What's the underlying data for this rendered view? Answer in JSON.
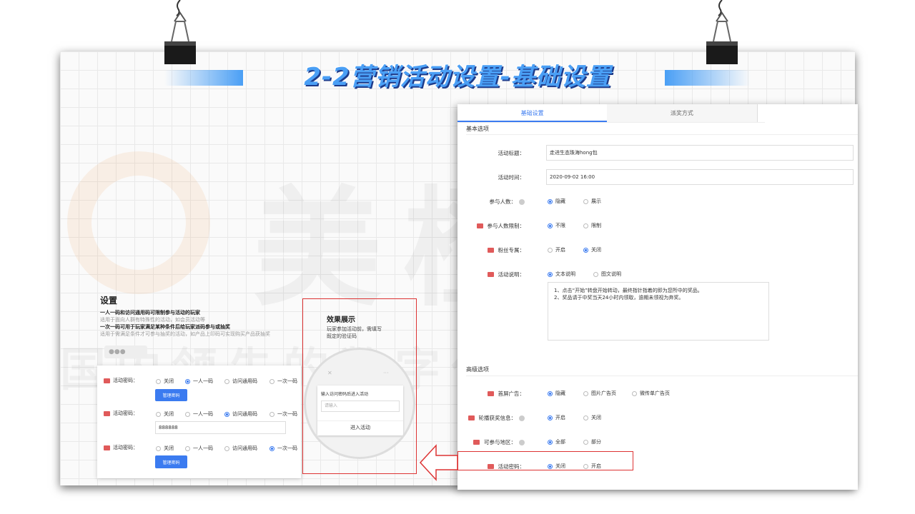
{
  "title": "2-2营销活动设置-基础设置",
  "watermark": {
    "big": "美橙互联",
    "line": "国内领先的数字化营销服务商"
  },
  "settings": {
    "heading": "设置",
    "lines": [
      {
        "text": "一人一码和访问通用码可限制参与活动的玩家",
        "style": "bold"
      },
      {
        "text": "适用于面向人群有特殊性的活动，如会员活动等",
        "style": "gray"
      },
      {
        "text": "一次一码可用于玩家满足某种条件后给玩家派码参与或抽奖",
        "style": "bold"
      },
      {
        "text": "适用于需满足条件才可参与抽奖的活动，如产品上印码可实现购买产品获抽奖",
        "style": "gray"
      }
    ],
    "placeholder_dots": "●●●"
  },
  "left_card": {
    "rows": [
      {
        "label": "活动密码：",
        "options": [
          "关闭",
          "一人一码",
          "访问通用码",
          "一次一码"
        ],
        "selected": 1,
        "button": "管理密码"
      },
      {
        "label": "活动密码：",
        "options": [
          "关闭",
          "一人一码",
          "访问通用码",
          "一次一码"
        ],
        "selected": 2,
        "input": "888888"
      },
      {
        "label": "活动密码：",
        "options": [
          "关闭",
          "一人一码",
          "访问通用码",
          "一次一码"
        ],
        "selected": 3,
        "button": "管理密码"
      }
    ]
  },
  "effect": {
    "heading": "效果展示",
    "desc1": "玩家参加活动前，需填写",
    "desc2": "既定的验证码",
    "modal_close": "✕",
    "modal_more": "···",
    "modal_title": "输入访问密码后进入活动",
    "modal_placeholder": "请输入",
    "modal_button": "进入活动"
  },
  "right_panel": {
    "tabs": [
      "基础设置",
      "派奖方式",
      ""
    ],
    "basic_section": "基本选项",
    "fields": {
      "activity_title_label": "活动标题：",
      "activity_title_value": "走进生态珠海hong包",
      "activity_time_label": "活动时间：",
      "activity_time_value": "2020-09-02 16:00",
      "participants_label": "参与人数：",
      "participants_opts": [
        "隐藏",
        "展示"
      ],
      "limit_label": "参与人数限制：",
      "limit_opts": [
        "不限",
        "限制"
      ],
      "fans_label": "粉丝专属：",
      "fans_opts": [
        "开启",
        "关闭"
      ],
      "desc_label": "活动说明：",
      "desc_opts": [
        "文本说明",
        "图文说明"
      ],
      "desc_text_1": "1、点击“开始”转盘开始转动，最终指针指着的即为您所中的奖品。",
      "desc_text_2": "2、奖品请于中奖当天24小时内领取，逾期未领视为弃奖。"
    },
    "advanced_section": "高级选项",
    "advanced": {
      "splash_label": "首屏广告：",
      "splash_opts": [
        "隐藏",
        "图片广告页",
        "微传单广告页"
      ],
      "carousel_label": "轮播获奖信息：",
      "carousel_opts": [
        "开启",
        "关闭"
      ],
      "region_label": "可参与地区：",
      "region_opts": [
        "全部",
        "部分"
      ],
      "password_label": "活动密码：",
      "password_opts": [
        "关闭",
        "开启"
      ]
    }
  },
  "colors": {
    "accent": "#3b7bf0",
    "highlight": "#d33333",
    "title": "#4a9ff5"
  }
}
